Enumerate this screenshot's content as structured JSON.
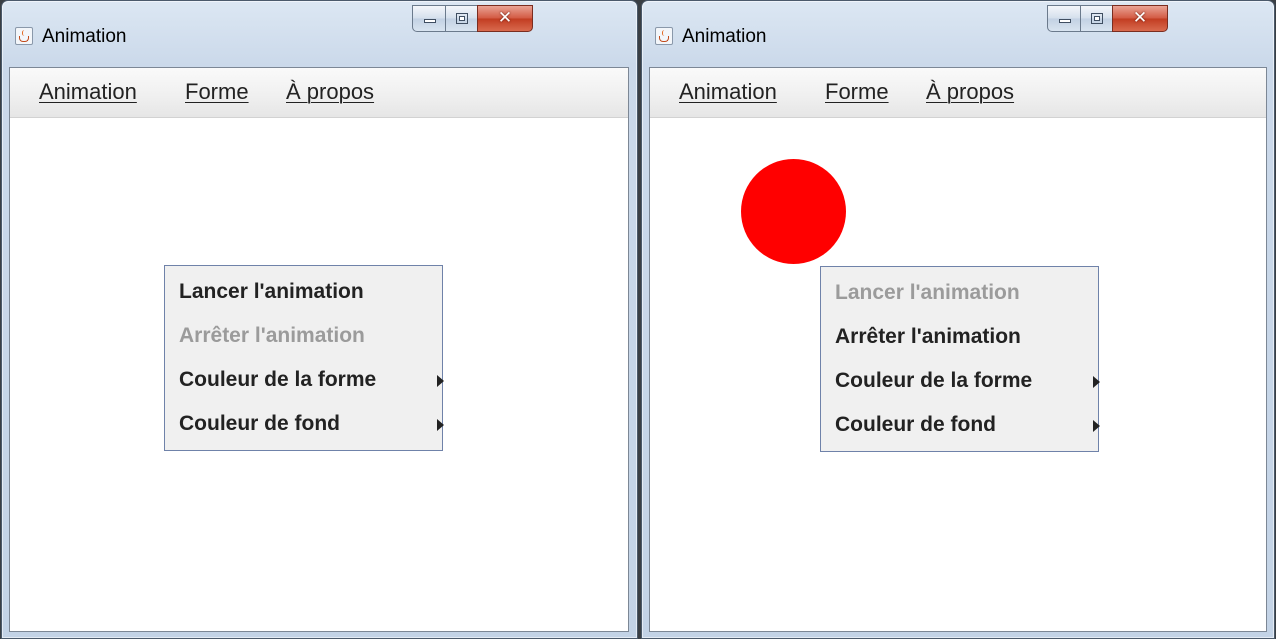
{
  "windows": [
    {
      "title": "Animation",
      "menus": [
        {
          "label": "Animation"
        },
        {
          "label": "Forme"
        },
        {
          "label": "À propos"
        }
      ],
      "popup": {
        "items": [
          {
            "label": "Lancer l'animation"
          },
          {
            "label": "Arrêter l'animation"
          },
          {
            "label": "Couleur de la forme"
          },
          {
            "label": "Couleur de fond"
          }
        ]
      }
    },
    {
      "title": "Animation",
      "menus": [
        {
          "label": "Animation"
        },
        {
          "label": "Forme"
        },
        {
          "label": "À propos"
        }
      ],
      "popup": {
        "items": [
          {
            "label": "Lancer l'animation"
          },
          {
            "label": "Arrêter l'animation"
          },
          {
            "label": "Couleur de la forme"
          },
          {
            "label": "Couleur de fond"
          }
        ]
      },
      "shape": {
        "kind": "circle",
        "color": "#ff0000"
      }
    }
  ],
  "icons": {
    "app": "java-cup-icon",
    "minimize": "minimize-icon",
    "maximize": "maximize-icon",
    "close": "close-icon",
    "submenu": "chevron-right-icon"
  }
}
